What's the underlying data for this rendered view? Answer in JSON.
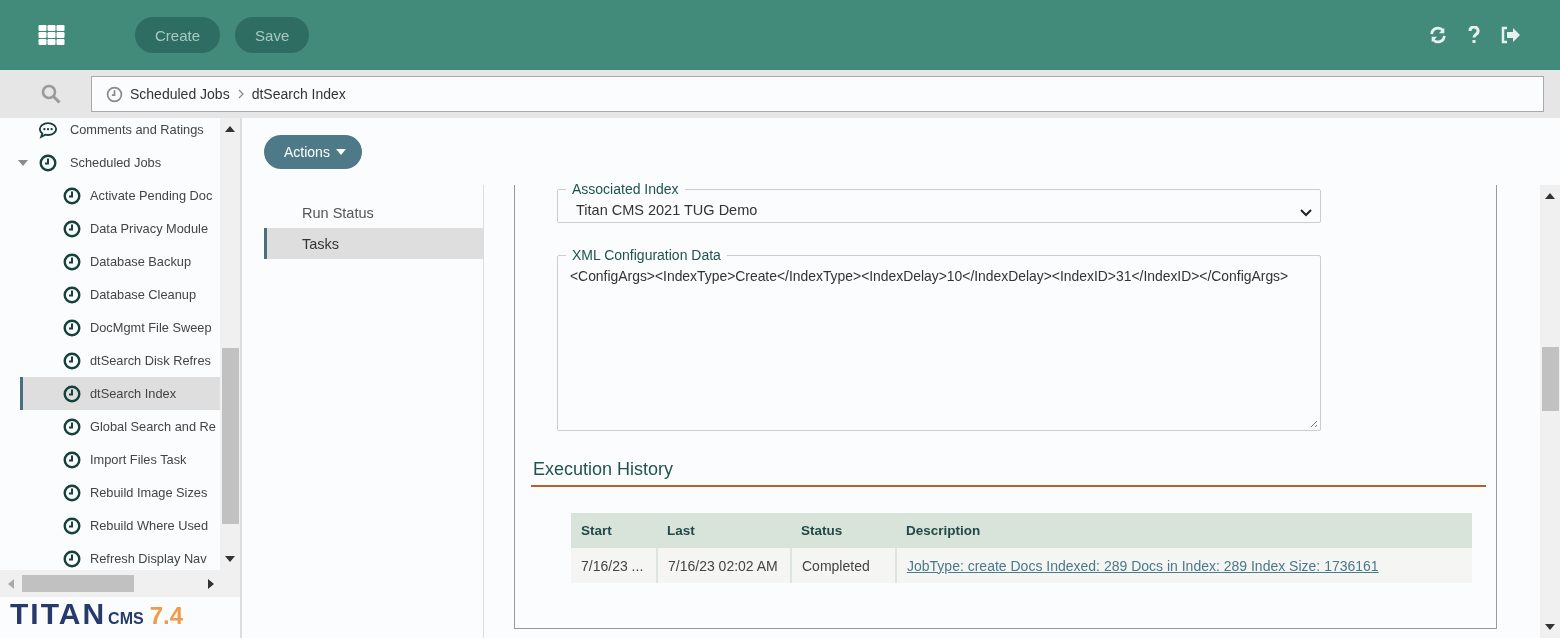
{
  "header": {
    "buttons": [
      {
        "label": "Create"
      },
      {
        "label": "Save"
      }
    ]
  },
  "breadcrumb": [
    "Scheduled Jobs",
    "dtSearch Index"
  ],
  "tree": [
    {
      "label": "Comments and Ratings",
      "kind": "comments",
      "selected": false
    },
    {
      "label": "Scheduled Jobs",
      "kind": "clock",
      "selected": false,
      "expanded": true,
      "children": [
        {
          "label": "Activate Pending Doc",
          "kind": "clock",
          "selected": false
        },
        {
          "label": "Data Privacy Module",
          "kind": "clock",
          "selected": false
        },
        {
          "label": "Database Backup",
          "kind": "clock",
          "selected": false
        },
        {
          "label": "Database Cleanup",
          "kind": "clock",
          "selected": false
        },
        {
          "label": "DocMgmt File Sweep",
          "kind": "clock",
          "selected": false
        },
        {
          "label": "dtSearch Disk Refres",
          "kind": "clock",
          "selected": false
        },
        {
          "label": "dtSearch Index",
          "kind": "clock",
          "selected": true
        },
        {
          "label": "Global Search and Re",
          "kind": "clock",
          "selected": false
        },
        {
          "label": "Import Files Task",
          "kind": "clock",
          "selected": false
        },
        {
          "label": "Rebuild Image Sizes",
          "kind": "clock",
          "selected": false
        },
        {
          "label": "Rebuild Where Used",
          "kind": "clock",
          "selected": false
        },
        {
          "label": "Refresh Display Nav",
          "kind": "clock",
          "selected": false
        }
      ]
    }
  ],
  "actions_button": "Actions",
  "tabs": [
    {
      "label": "Run Status",
      "selected": false
    },
    {
      "label": "Tasks",
      "selected": true
    }
  ],
  "associated_index": {
    "label": "Associated Index",
    "value": "Titan CMS 2021 TUG Demo"
  },
  "xml_config": {
    "label": "XML Configuration Data",
    "value": "<ConfigArgs><IndexType>Create</IndexType><IndexDelay>10</IndexDelay><IndexID>31</IndexID></ConfigArgs>"
  },
  "execution_history": {
    "title": "Execution History",
    "columns": [
      "Start",
      "Last",
      "Status",
      "Description"
    ],
    "rows": [
      {
        "start": "7/16/23 ...",
        "last": "7/16/23 02:02 AM",
        "status": "Completed",
        "description": "JobType: create Docs Indexed: 289 Docs in Index: 289 Index Size: 1736161"
      }
    ]
  },
  "logo": {
    "wordmark": "TITAN",
    "suffix": "CMS",
    "version": "7.4"
  }
}
